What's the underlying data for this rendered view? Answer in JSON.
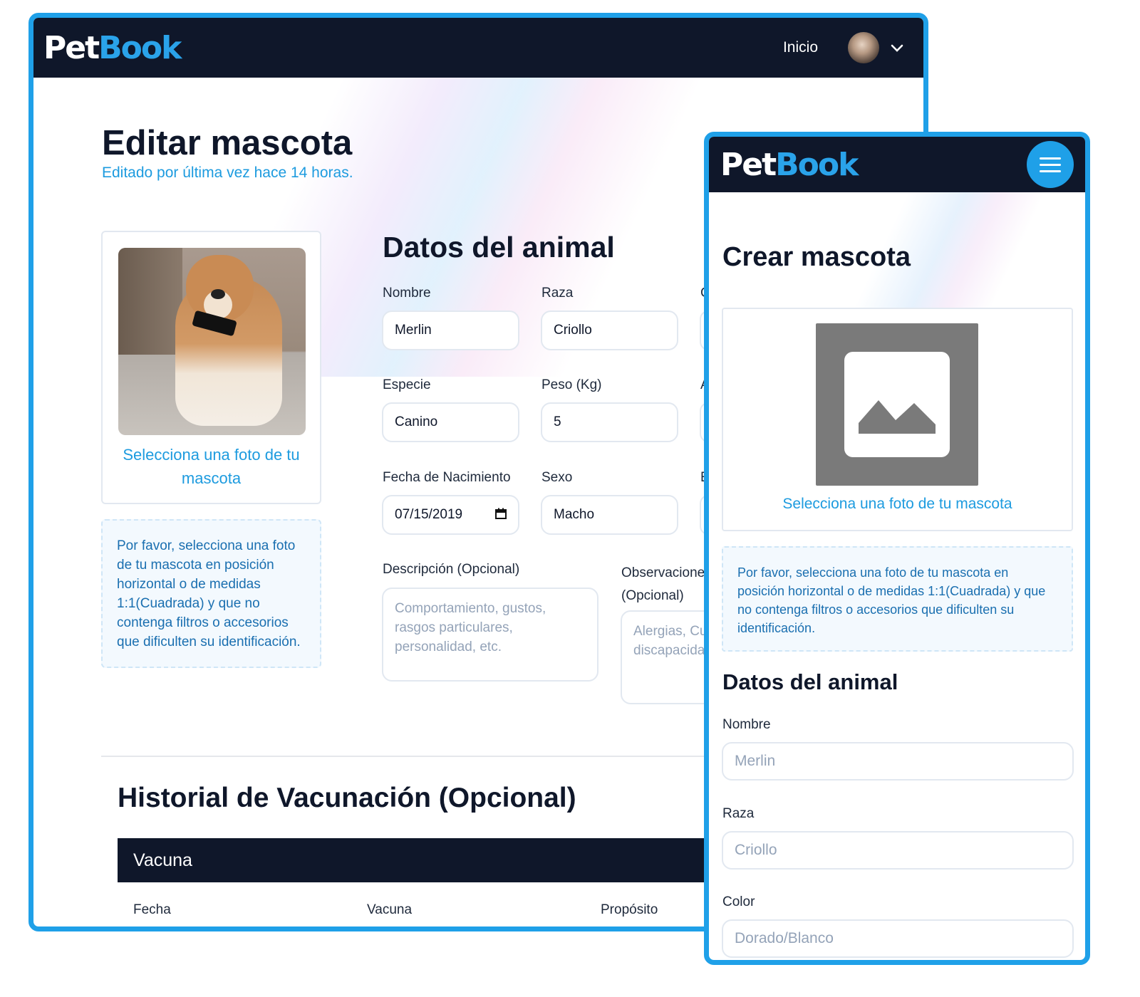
{
  "brand": {
    "part1": "Pet",
    "part2": "Book",
    "accent": "#2aa3ea",
    "nav_bg": "#0f172a"
  },
  "desktop": {
    "nav": {
      "link": "Inicio"
    },
    "title": "Editar mascota",
    "subtitle": "Editado por última vez hace 14 horas.",
    "photo_link": "Selecciona una foto de tu mascota",
    "notice": "Por favor, selecciona una foto de tu mascota en posición horizontal o de medidas 1:1(Cuadrada) y que no contenga filtros o accesorios que dificulten su identificación.",
    "section": "Datos del animal",
    "fields": {
      "nombre": {
        "label": "Nombre",
        "value": "Merlin"
      },
      "raza": {
        "label": "Raza",
        "value": "Criollo"
      },
      "especie": {
        "label": "Especie",
        "value": "Canino"
      },
      "peso": {
        "label": "Peso (Kg)",
        "value": "5"
      },
      "fecha": {
        "label": "Fecha de Nacimiento",
        "value": "07/15/2019"
      },
      "sexo": {
        "label": "Sexo",
        "value": "Macho"
      },
      "descripcion": {
        "label": "Descripción (Opcional)",
        "placeholder": "Comportamiento, gustos, rasgos particulares, personalidad, etc."
      },
      "observaciones": {
        "label": "Observaciones (Opcional)",
        "placeholder": "Alergias, Cu discapacida"
      }
    },
    "partial_labels": [
      "C",
      "A",
      "E"
    ],
    "history": {
      "title": "Historial de Vacunación (Opcional)",
      "table_title": "Vacuna",
      "columns": [
        "Fecha",
        "Vacuna",
        "Propósito"
      ]
    }
  },
  "mobile": {
    "title": "Crear mascota",
    "photo_link": "Selecciona una foto de tu mascota",
    "notice": "Por favor, selecciona una foto de tu mascota en posición horizontal o de medidas 1:1(Cuadrada) y que no contenga filtros o accesorios que dificulten su identificación.",
    "section": "Datos del animal",
    "fields": [
      {
        "label": "Nombre",
        "placeholder": "Merlin"
      },
      {
        "label": "Raza",
        "placeholder": "Criollo"
      },
      {
        "label": "Color",
        "placeholder": "Dorado/Blanco"
      }
    ]
  }
}
